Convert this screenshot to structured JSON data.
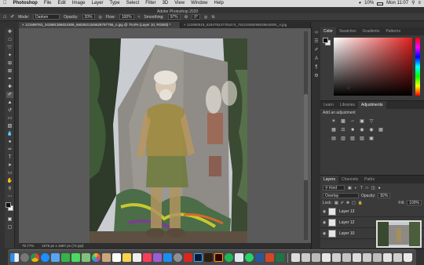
{
  "menubar": {
    "apple": "",
    "app": "Photoshop",
    "items": [
      "File",
      "Edit",
      "Image",
      "Layer",
      "Type",
      "Select",
      "Filter",
      "3D",
      "View",
      "Window",
      "Help"
    ],
    "battery": "10%",
    "clock": "Mon 11:07"
  },
  "window_title": "Adobe Photoshop 2020",
  "options": {
    "mode_label": "Mode:",
    "mode_value": "Darken",
    "opacity_label": "Opacity:",
    "opacity_value": "20%",
    "flow_label": "Flow:",
    "flow_value": "100%",
    "smoothing_label": "Smoothing:",
    "smoothing_value": "97%",
    "angle_value": "0°"
  },
  "tabs": [
    {
      "label": "121599763_343891356024309_6602621345628797766_n.jpg @ 75.8% (Layer 10, RGB/8) *",
      "active": true
    },
    {
      "label": "122880519_629476247784474_76210408298539640091_n.jpg",
      "active": false
    }
  ],
  "status": {
    "zoom": "75.77%",
    "doc_size": "1076 px x 1687 px (72 ppi)"
  },
  "color_panel": {
    "tabs": [
      "Color",
      "Swatches",
      "Gradients",
      "Patterns"
    ],
    "hue": "#e0201e"
  },
  "adjustments_panel": {
    "tabs": [
      "Learn",
      "Libraries",
      "Adjustments"
    ],
    "add_label": "Add an adjustment"
  },
  "layers_panel": {
    "tabs": [
      "Layers",
      "Channels",
      "Paths"
    ],
    "kind_label": "Kind",
    "blend_mode": "Overlay",
    "opacity_label": "Opacity:",
    "opacity_value": "82%",
    "lock_label": "Lock:",
    "fill_label": "Fill:",
    "fill_value": "100%",
    "layers": [
      {
        "name": "Layer 13"
      },
      {
        "name": "Layer 12"
      },
      {
        "name": "Layer 10"
      }
    ]
  }
}
